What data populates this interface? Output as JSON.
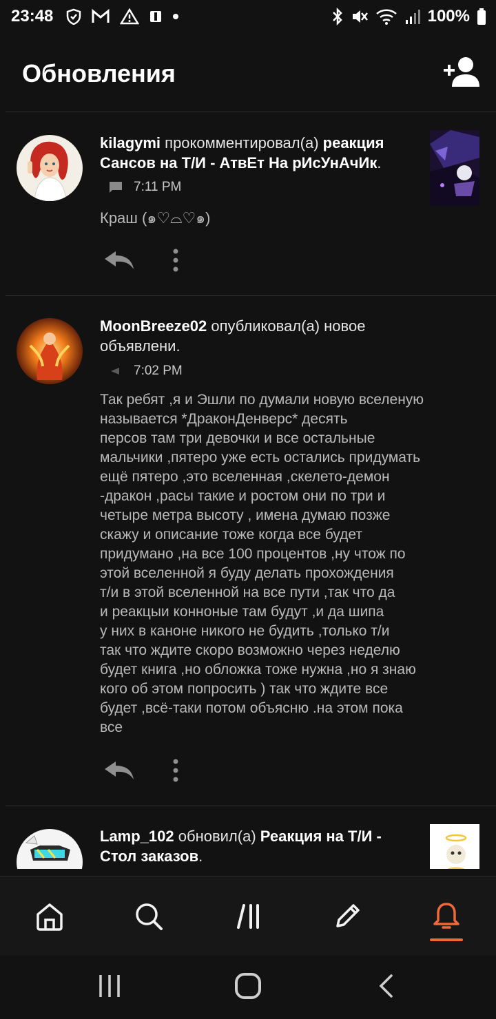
{
  "status": {
    "time": "23:48",
    "battery": "100%"
  },
  "header": {
    "title": "Обновления"
  },
  "items": [
    {
      "user": "kilagymi",
      "action": " прокомментировал(а) ",
      "target": "реакция Сансов на Т/И - АтвЕт На рИсУнАчИк",
      "suffix": ".",
      "time": "7:11 PM",
      "body": "Краш (๑♡⌓♡๑)"
    },
    {
      "user": "MoonBreeze02",
      "action": " опубликовал(а) новое объявлени",
      "target": "",
      "suffix": ".",
      "time": "7:02 PM",
      "body": "Так ребят ,я и Эшли по думали новую вселеную\nназывается *ДраконДенверс* десять\nперсов там три девочки и все остальные\nмальчики ,пятеро уже есть остались придумать\nещё пятеро ,это вселенная ,скелето-демон\n-дракон ,расы такие и ростом они по три и\nчетыре метра высоту , имена думаю позже\nскажу и описание тоже когда все будет\nпридумано ,на все 100 процентов ,ну чтож по\nэтой вселенной я буду делать прохождения\nт/и в этой вселенной на все пути ,так что да\nи реакцыи конноные там будут ,и да шипа\nу них в каноне никого не будить ,только т/и\nтак что ждите скоро возможно через неделю\nбудет книга ,но обложка тоже нужна ,но я знаю\nкого об этом попросить ) так что ждите все\nбудет ,всё-таки потом объясню .на этом пока\nвсе"
    },
    {
      "user": "Lamp_102",
      "action": " обновил(а) ",
      "target": "Реакция на Т/И - Стол заказов",
      "suffix": "."
    }
  ],
  "colors": {
    "accent": "#f0683a",
    "background": "#121212",
    "text": "#ffffff",
    "muted": "#b9b9b9"
  },
  "nav": [
    "home-icon",
    "search-icon",
    "library-icon",
    "pencil-icon",
    "bell-icon"
  ],
  "sysnav": [
    "recents-icon",
    "home-circle-icon",
    "back-icon"
  ]
}
